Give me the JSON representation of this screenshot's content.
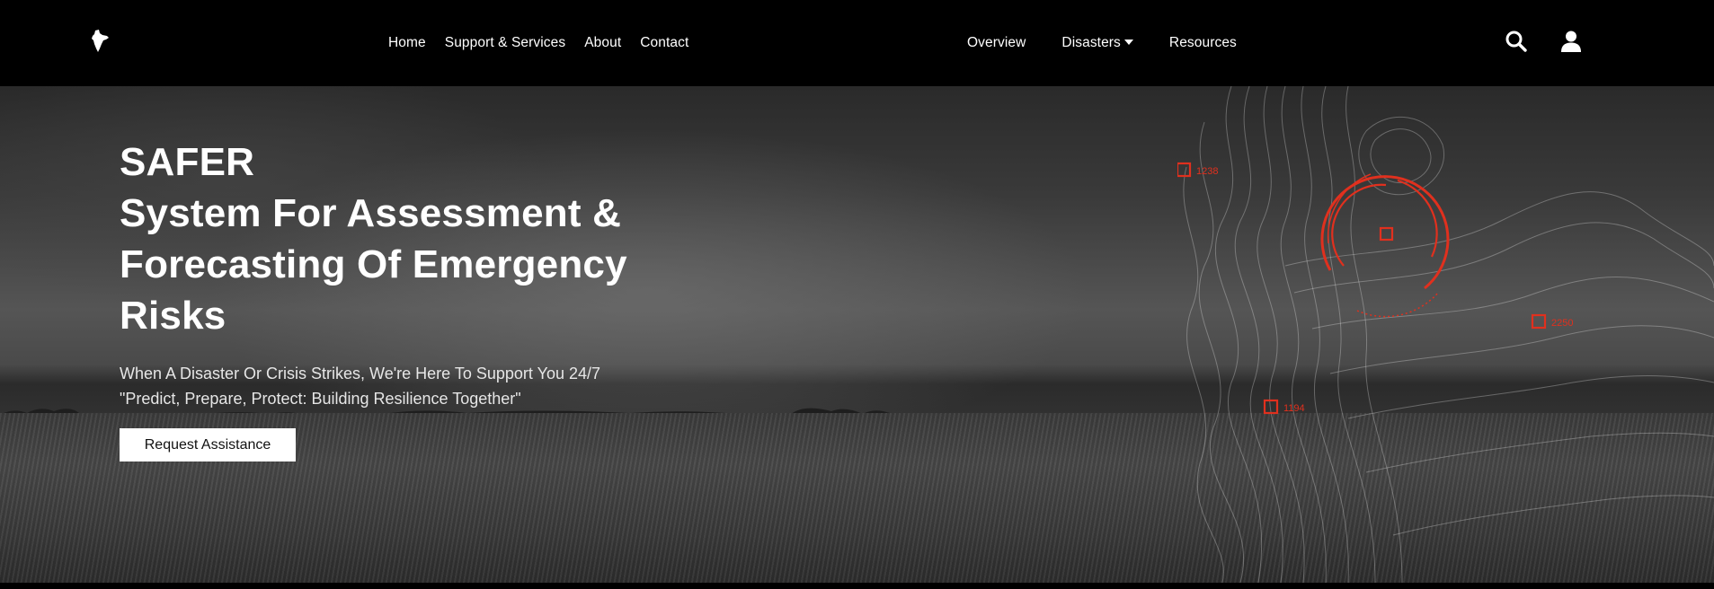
{
  "nav": {
    "logo_icon": "india-map-icon",
    "left_links": [
      "Home",
      "Support & Services",
      "About",
      "Contact"
    ],
    "right_links": {
      "overview": "Overview",
      "disasters": "Disasters",
      "resources": "Resources"
    },
    "search_icon": "search-icon",
    "user_icon": "user-icon"
  },
  "hero": {
    "title_line1": "SAFER",
    "title_line2": "System For Assessment &",
    "title_line3": "Forecasting Of Emergency",
    "title_line4": "Risks",
    "subtitle_line1": "When A Disaster Or Crisis Strikes, We're Here To Support You 24/7",
    "subtitle_line2": "\"Predict, Prepare, Protect: Building Resilience Together\"",
    "cta_label": "Request Assistance"
  },
  "map_markers": [
    "1238",
    "2250",
    "1194"
  ],
  "colors": {
    "nav_bg": "#000000",
    "accent": "#e0301e",
    "text": "#ffffff"
  }
}
